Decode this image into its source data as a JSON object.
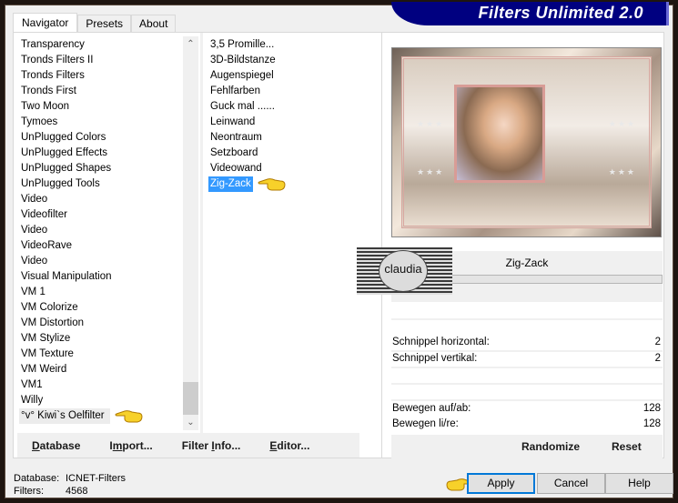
{
  "header": {
    "title": "Filters Unlimited 2.0"
  },
  "tabs": [
    {
      "label": "Navigator",
      "active": true
    },
    {
      "label": "Presets",
      "active": false
    },
    {
      "label": "About",
      "active": false
    }
  ],
  "categories": {
    "items": [
      "Transparency",
      "Tronds Filters II",
      "Tronds Filters",
      "Tronds First",
      "Two Moon",
      "Tymoes",
      "UnPlugged Colors",
      "UnPlugged Effects",
      "UnPlugged Shapes",
      "UnPlugged Tools",
      "Video",
      "Videofilter",
      "Video",
      "VideoRave",
      "Video",
      "Visual Manipulation",
      "VM 1",
      "VM Colorize",
      "VM Distortion",
      "VM Stylize",
      "VM Texture",
      "VM Weird",
      "VM1",
      "Willy",
      "°v° Kiwi`s Oelfilter"
    ],
    "selected": "°v° Kiwi`s Oelfilter"
  },
  "filters": {
    "items": [
      "3,5 Promille...",
      "3D-Bildstanze",
      "Augenspiegel",
      "Fehlfarben",
      "Guck mal ......",
      "Leinwand",
      "Neontraum",
      "Setzboard",
      "Videowand",
      "Zig-Zack"
    ],
    "selected": "Zig-Zack"
  },
  "bottom_buttons": {
    "database": {
      "pre": "",
      "u": "D",
      "post": "atabase"
    },
    "import": {
      "pre": "I",
      "u": "m",
      "post": "port..."
    },
    "filter_info": {
      "pre": "Filter ",
      "u": "I",
      "post": "nfo..."
    },
    "editor": {
      "pre": "",
      "u": "E",
      "post": "ditor..."
    }
  },
  "preview": {
    "logo_text": "claudia",
    "stars": "★★★"
  },
  "current_filter": {
    "name": "Zig-Zack"
  },
  "params": [
    {
      "label": "Schnippel horizontal:",
      "value": "2"
    },
    {
      "label": "Schnippel vertikal:",
      "value": "2"
    },
    {
      "label": "Bewegen auf/ab:",
      "value": "128"
    },
    {
      "label": "Bewegen li/re:",
      "value": "128"
    }
  ],
  "param_buttons": {
    "randomize": "Randomize",
    "reset": "Reset"
  },
  "status": {
    "database_label": "Database:",
    "database_value": "ICNET-Filters",
    "filters_label": "Filters:",
    "filters_value": "4568"
  },
  "dialog_buttons": {
    "apply": "Apply",
    "cancel": "Cancel",
    "help": "Help"
  },
  "scrollbar": {
    "up": "⌃",
    "down": "⌄"
  },
  "colors": {
    "accent": "#3399ff",
    "banner": "#000080",
    "default_button_border": "#0078d7"
  }
}
